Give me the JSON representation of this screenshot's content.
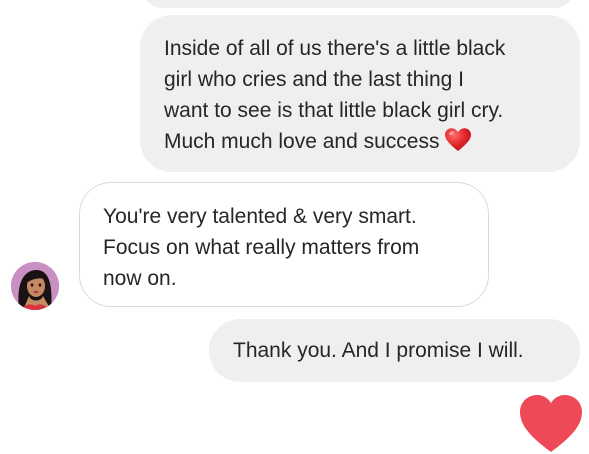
{
  "conversation": {
    "messages": [
      {
        "direction": "sent",
        "lines": [
          "Inside of all of us there's a little black",
          "girl who cries and the last thing I",
          "want to see is that little black girl cry.",
          "Much much love and success"
        ],
        "emoji": "red-heart"
      },
      {
        "direction": "received",
        "lines": [
          "You're very talented & very smart.",
          "Focus on what really matters from",
          "now on."
        ]
      },
      {
        "direction": "sent",
        "lines": [
          "Thank you. And I promise I will."
        ]
      }
    ],
    "colors": {
      "sent_bubble": "#efefef",
      "received_border": "#dbdbdb",
      "text": "#262626",
      "heart": "#ed4956"
    },
    "icons": {
      "inline_emoji": "heart-emoji-icon",
      "like_button": "heart-like-icon"
    }
  }
}
